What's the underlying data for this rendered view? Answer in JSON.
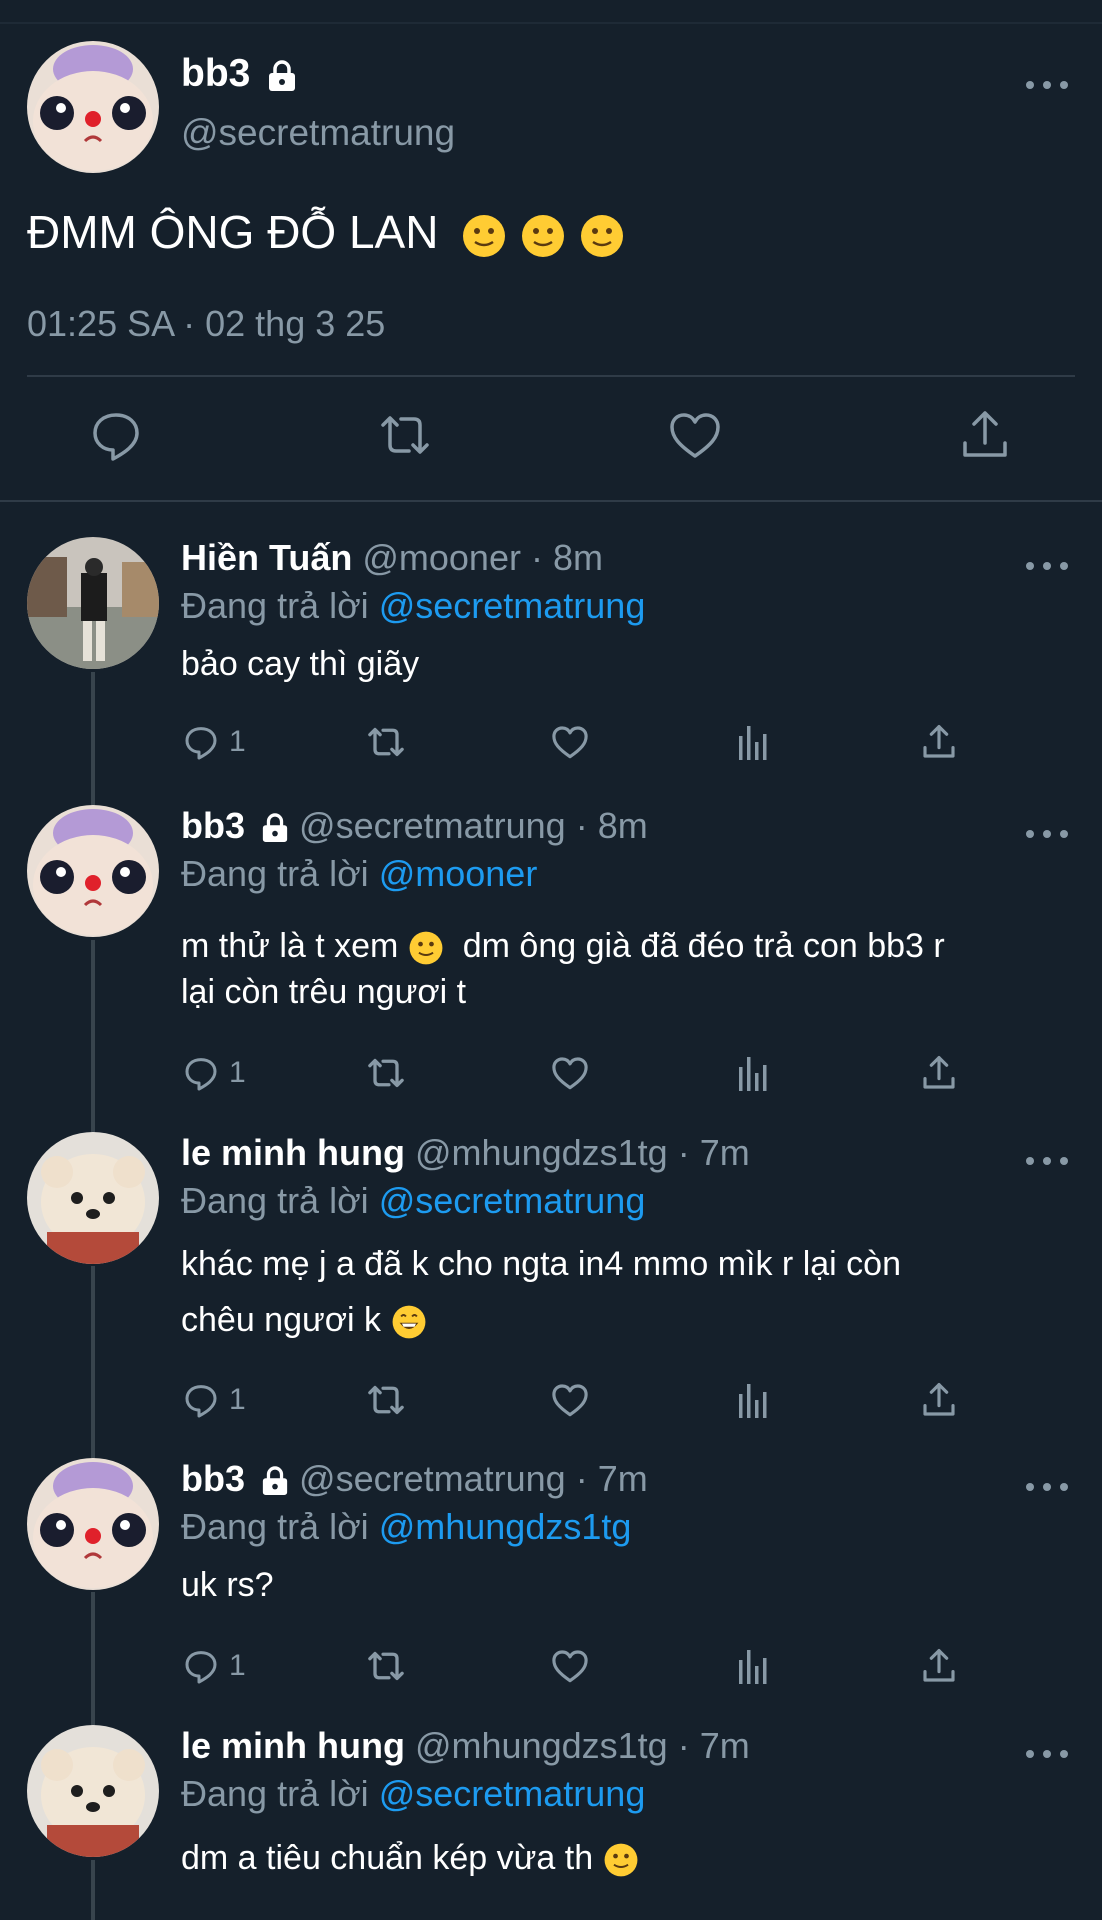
{
  "main_tweet": {
    "name": "bb3",
    "handle": "@secretmatrung",
    "text": "ĐMM ÔNG ĐỖ LAN",
    "emojis": [
      "slightly-smiling-face",
      "slightly-smiling-face",
      "slightly-smiling-face"
    ],
    "timestamp": "01:25 SA · 02 thg 3 25",
    "icons": [
      "reply-icon",
      "retweet-icon",
      "like-icon",
      "share-icon"
    ]
  },
  "replies": [
    {
      "name": "Hiền Tuấn",
      "handle": "@mooner",
      "time": "· 8m",
      "replying_prefix": "Đang trả lời",
      "replying_to": "@secretmatrung",
      "text": "bảo cay thì giãy",
      "reply_count": "1"
    },
    {
      "name": "bb3",
      "handle": "@secretmatrung",
      "time": "· 8m",
      "replying_prefix": "Đang trả lời",
      "replying_to": "@mooner",
      "text_a": "m thử là t xem",
      "text_b": "dm ông già đã đéo trả con bb3 r",
      "text_c": "lại còn trêu ngươi t",
      "reply_count": "1"
    },
    {
      "name": "le minh hung",
      "handle": "@mhungdzs1tg",
      "time": "· 7m",
      "replying_prefix": "Đang trả lời",
      "replying_to": "@secretmatrung",
      "text_a": "khác mẹ j a đã k cho ngta in4 mmo mìk r lại còn",
      "text_b": "chêu ngươi k",
      "reply_count": "1"
    },
    {
      "name": "bb3",
      "handle": "@secretmatrung",
      "time": "· 7m",
      "replying_prefix": "Đang trả lời",
      "replying_to": "@mhungdzs1tg",
      "text": "uk rs?",
      "reply_count": "1"
    },
    {
      "name": "le minh hung",
      "handle": "@mhungdzs1tg",
      "time": "· 7m",
      "replying_prefix": "Đang trả lời",
      "replying_to": "@secretmatrung",
      "text": "dm a tiêu chuẩn kép vừa th"
    }
  ],
  "colors": {
    "background": "#15202b",
    "secondary_text": "#8899a6",
    "link": "#1d9bf0",
    "divider": "#2f3b47"
  }
}
